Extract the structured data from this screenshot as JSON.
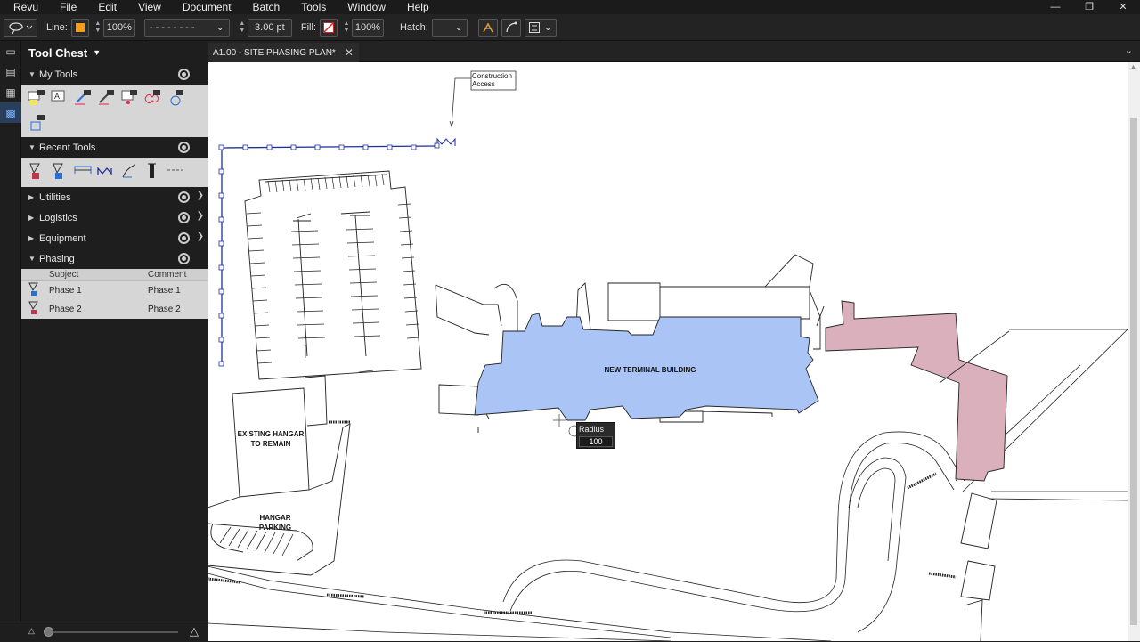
{
  "menubar": {
    "items": [
      "Revu",
      "File",
      "Edit",
      "View",
      "Document",
      "Batch",
      "Tools",
      "Window",
      "Help"
    ]
  },
  "toolbar": {
    "line_label": "Line:",
    "line_color": "#f39c1e",
    "line_opacity": "100%",
    "line_style": "- - - - - - - -",
    "line_width": "3.00 pt",
    "fill_label": "Fill:",
    "fill_opacity": "100%",
    "hatch_label": "Hatch:"
  },
  "tool_chest": {
    "title": "Tool Chest",
    "sections": {
      "my_tools": "My Tools",
      "recent_tools": "Recent Tools",
      "utilities": "Utilities",
      "logistics": "Logistics",
      "equipment": "Equipment",
      "phasing": "Phasing"
    },
    "phasing_table": {
      "headers": {
        "subject": "Subject",
        "comment": "Comment"
      },
      "rows": [
        {
          "subject": "Phase 1",
          "comment": "Phase 1"
        },
        {
          "subject": "Phase 2",
          "comment": "Phase 2"
        }
      ]
    }
  },
  "document_tab": {
    "label": "A1.00 - SITE  PHASING PLAN*"
  },
  "drawing": {
    "callout": "Construction\nAccess",
    "new_terminal": "NEW TERMINAL BUILDING",
    "existing_hangar": "EXISTING HANGAR\nTO REMAIN",
    "hangar_parking": "HANGAR\nPARKING",
    "tooltip_label": "Radius",
    "tooltip_value": "100",
    "terminal_color": "#a9c4f5",
    "pink_building_color": "#d9b0bb",
    "markup_color": "#1f2e9c"
  }
}
